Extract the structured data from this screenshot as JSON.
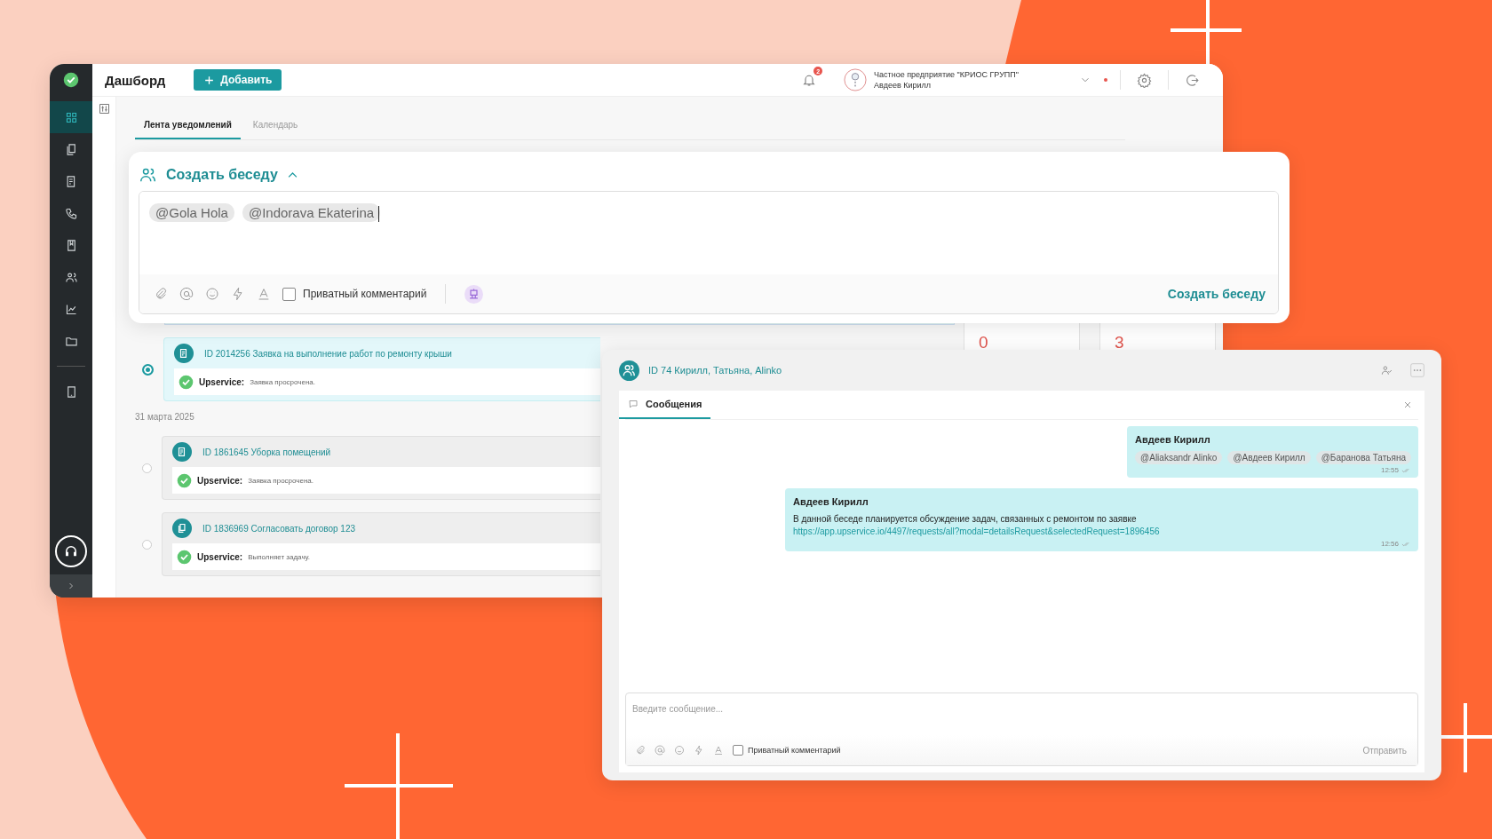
{
  "sidebar": {
    "items": [
      {
        "selected": true
      },
      {
        "selected": false
      },
      {
        "selected": false
      },
      {
        "selected": false
      },
      {
        "selected": false
      },
      {
        "selected": false
      },
      {
        "selected": false
      },
      {
        "selected": false
      },
      {
        "selected": false
      }
    ]
  },
  "header": {
    "title": "Дашборд",
    "add_button": "Добавить",
    "notification_count": "2",
    "account": {
      "company": "Частное предприятие \"КРИОС ГРУПП\"",
      "user": "Авдеев Кирилл"
    }
  },
  "tabs": [
    {
      "label": "Лента уведомлений",
      "selected": true
    },
    {
      "label": "Календарь",
      "selected": false
    }
  ],
  "create_conversation": {
    "title": "Создать беседу",
    "expanded": true,
    "mentions": [
      "@Gola Hola",
      "@Indorava Ekaterina"
    ],
    "private_comment": {
      "label": "Приватный комментарий",
      "checked": false
    },
    "submit": "Создать беседу"
  },
  "feed": [
    {
      "kind": "item",
      "title": "ID 2014256 Заявка на выполнение работ по ремонту крыши",
      "source": "Upservice:",
      "status": "Заявка просрочена.",
      "selected": true
    },
    {
      "kind": "date",
      "label": "31 марта 2025"
    },
    {
      "kind": "item",
      "title": "ID 1861645 Уборка помещений",
      "source": "Upservice:",
      "status": "Заявка просрочена.",
      "selected": false
    },
    {
      "kind": "item",
      "title": "ID 1836969 Согласовать договор 123",
      "source": "Upservice:",
      "status": "Выполняет задачу.",
      "selected": false
    }
  ],
  "stats": [
    {
      "value": "0"
    },
    {
      "value": "3"
    }
  ],
  "chat": {
    "title": "ID 74 Кирилл, Татьяна, Alinko",
    "tabs": [
      {
        "label": "Сообщения",
        "selected": true
      }
    ],
    "messages": [
      {
        "author": "Авдеев Кирилл",
        "mentions": [
          "@Aliaksandr Alinko",
          "@Авдеев Кирилл",
          "@Баранова Татьяна"
        ],
        "time": "12:55"
      },
      {
        "author": "Авдеев Кирилл",
        "text": "В данной беседе планируется обсуждение задач, связанных с ремонтом по заявке",
        "link": "https://app.upservice.io/4497/requests/all?modal=detailsRequest&selectedRequest=1896456",
        "time": "12:56"
      }
    ],
    "input": {
      "placeholder": "Введите сообщение..."
    },
    "private_comment": {
      "label": "Приватный комментарий",
      "checked": false
    },
    "send": "Отправить"
  }
}
